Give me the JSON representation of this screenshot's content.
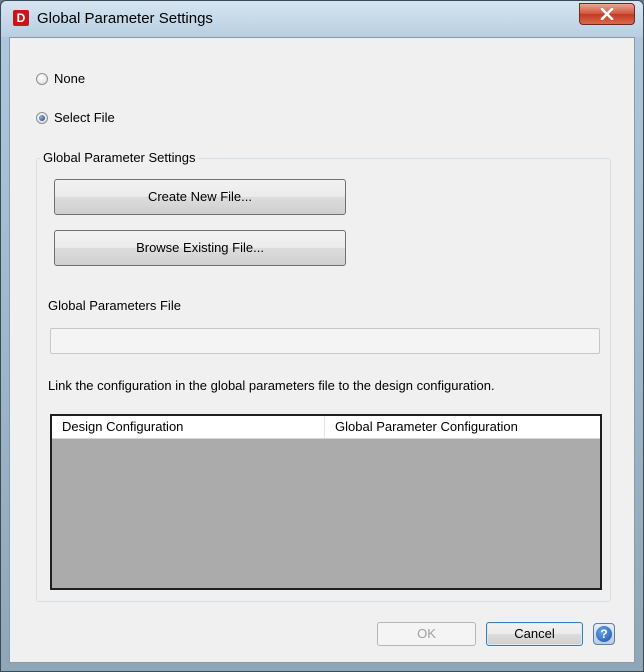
{
  "window": {
    "title": "Global Parameter Settings",
    "app_icon_letter": "D",
    "close_icon": "close-icon"
  },
  "options": {
    "none_label": "None",
    "select_file_label": "Select File",
    "selected": "Select File"
  },
  "group": {
    "caption": "Global Parameter Settings",
    "create_button": "Create New File...",
    "browse_button": "Browse Existing File...",
    "file_label": "Global Parameters File",
    "file_value": "",
    "link_text": "Link the configuration in the global parameters file to the design configuration.",
    "table": {
      "columns": [
        "Design Configuration",
        "Global Parameter Configuration"
      ],
      "rows": []
    }
  },
  "footer": {
    "ok_label": "OK",
    "cancel_label": "Cancel",
    "help_icon": "help-icon",
    "help_glyph": "?"
  }
}
